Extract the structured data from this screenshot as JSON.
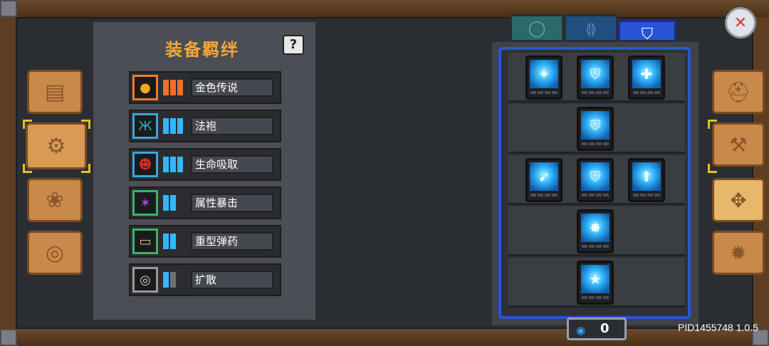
{
  "left_panel": {
    "title": "装备羁绊",
    "help_label": "?",
    "bonds": [
      {
        "label": "金色传说",
        "icon": "flame-orb-icon",
        "frame_color": "#f07a2a",
        "bar_color": "#f0702a",
        "bars_active": 3,
        "bars_total": 3
      },
      {
        "label": "法袍",
        "icon": "robe-icon",
        "frame_color": "#3aa6d8",
        "bar_color": "#33b6ff",
        "bars_active": 3,
        "bars_total": 3
      },
      {
        "label": "生命吸取",
        "icon": "demon-face-icon",
        "frame_color": "#3aa6d8",
        "bar_color": "#33b6ff",
        "bars_active": 3,
        "bars_total": 3
      },
      {
        "label": "属性暴击",
        "icon": "purple-burst-icon",
        "frame_color": "#3bb36b",
        "bar_color": "#33b6ff",
        "bars_active": 2,
        "bars_total": 2
      },
      {
        "label": "重型弹药",
        "icon": "bullet-icon",
        "frame_color": "#3bb36b",
        "bar_color": "#33b6ff",
        "bars_active": 2,
        "bars_total": 2
      },
      {
        "label": "扩散",
        "icon": "spiral-icon",
        "frame_color": "#9a9a9a",
        "bar_color": "#33b6ff",
        "bars_active": 1,
        "bars_total": 2
      }
    ]
  },
  "right_panel": {
    "tabs": [
      {
        "name": "tab-skill-1",
        "icon": "ring-icon"
      },
      {
        "name": "tab-skill-2",
        "icon": "wings-icon"
      },
      {
        "name": "tab-skill-3",
        "icon": "shield-icon",
        "active": true
      }
    ],
    "tiers": [
      {
        "skills": [
          {
            "icon": "starburst-icon"
          },
          {
            "icon": "shield-slash-icon"
          },
          {
            "icon": "plus-shield-icon"
          }
        ]
      },
      {
        "skills": [
          {
            "icon": "shield-icon"
          }
        ]
      },
      {
        "skills": [
          {
            "icon": "dash-icon"
          },
          {
            "icon": "shield-beam-icon"
          },
          {
            "icon": "shield-up-icon"
          }
        ]
      },
      {
        "skills": [
          {
            "icon": "impact-icon"
          }
        ]
      },
      {
        "skills": [
          {
            "icon": "star-shield-icon"
          }
        ]
      }
    ],
    "counter": {
      "value": "0",
      "icon": "gem-icon"
    }
  },
  "left_tabs": [
    {
      "icon": "book-icon"
    },
    {
      "icon": "crafting-icon",
      "active": true
    },
    {
      "icon": "pets-icon"
    },
    {
      "icon": "steering-icon"
    }
  ],
  "right_tabs": [
    {
      "icon": "helmet-icon"
    },
    {
      "icon": "tools-icon"
    },
    {
      "icon": "compass-icon",
      "active": true
    },
    {
      "icon": "gear-icon"
    }
  ],
  "close_icon": "close-icon",
  "footer": {
    "pid": "PID1455748 1.0.5"
  }
}
